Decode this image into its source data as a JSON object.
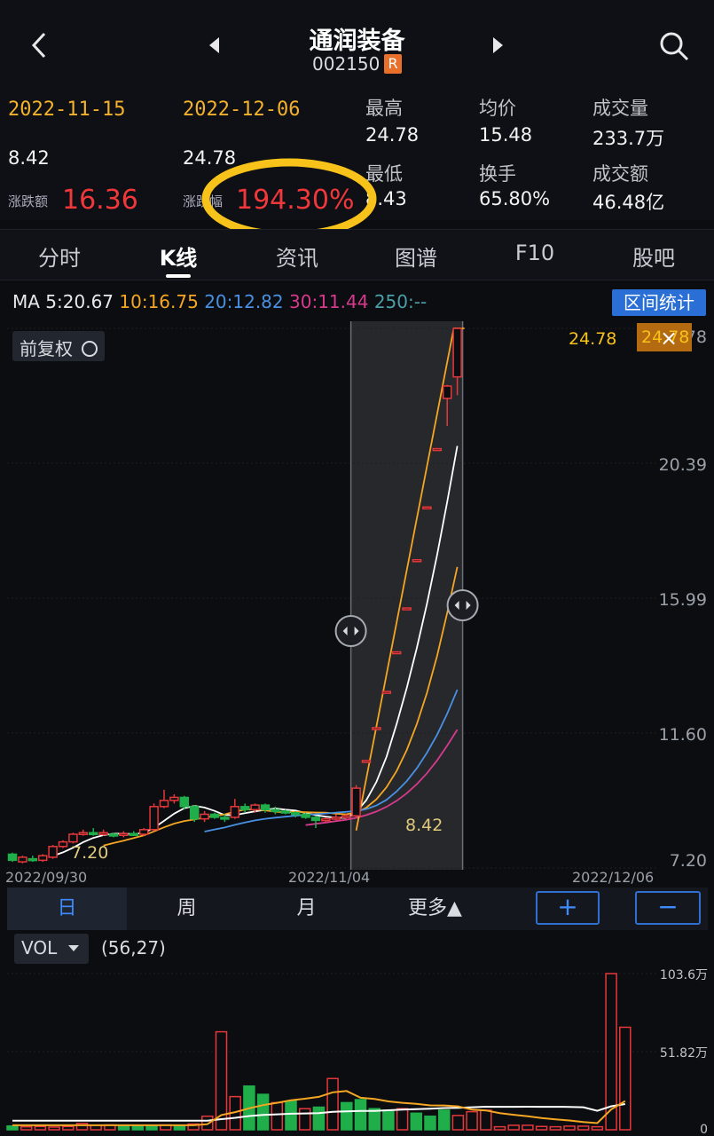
{
  "header": {
    "title": "通润装备",
    "code": "002150",
    "code_badge": "R"
  },
  "stats": {
    "start_date": "2022-11-15",
    "end_date": "2022-12-06",
    "start_price": "8.42",
    "end_price": "24.78",
    "change_label": "涨跌额",
    "change_value": "16.36",
    "pct_label": "涨跌幅",
    "pct_value": "194.30%",
    "high_label": "最高",
    "high_value": "24.78",
    "low_label": "最低",
    "low_value": "8.43",
    "avg_label": "均价",
    "avg_value": "15.48",
    "turnover_label": "换手",
    "turnover_value": "65.80%",
    "volume_label": "成交量",
    "volume_value": "233.7万",
    "amount_label": "成交额",
    "amount_value": "46.48亿"
  },
  "tabs": [
    "分时",
    "K线",
    "资讯",
    "图谱",
    "F10",
    "股吧"
  ],
  "ma_line": {
    "prefix": "MA",
    "ma5": "5:20.67",
    "ma10": "10:16.75",
    "ma20": "20:12.82",
    "ma30": "30:11.44",
    "ma250": "250:--"
  },
  "range_stats_button": "区间统计",
  "adjust_button": "前复权",
  "period_buttons": [
    "日",
    "周",
    "月",
    "更多▲"
  ],
  "zoom_in": "+",
  "zoom_out": "−",
  "volume_panel": {
    "selector": "VOL",
    "params": "(56,27)",
    "axis_labels": [
      "103.6万",
      "51.82万",
      "0"
    ]
  },
  "colors": {
    "up": "#e5383b",
    "down": "#1fae4a",
    "ma5": "#ffffff",
    "ma10": "#f5a623",
    "ma20": "#4a90e2",
    "ma30": "#d63a8c",
    "highlight": "#f7c21a",
    "accent": "#2a6fd6"
  },
  "chart_data": {
    "type": "candlestick",
    "price_axis": [
      "24.78",
      "20.39",
      "15.99",
      "11.60",
      "7.20"
    ],
    "price_ylim": [
      7.2,
      24.78
    ],
    "date_labels": [
      "2022/09/30",
      "2022/11/04",
      "2022/12/06"
    ],
    "markers": {
      "high_label": "24.78",
      "start_marker": "8.42",
      "low_marker": "7.20",
      "close_tag": "24.78"
    },
    "candles": [
      {
        "o": 7.65,
        "c": 7.45,
        "h": 7.7,
        "l": 7.4
      },
      {
        "o": 7.4,
        "c": 7.55,
        "h": 7.6,
        "l": 7.35
      },
      {
        "o": 7.5,
        "c": 7.45,
        "h": 7.6,
        "l": 7.4
      },
      {
        "o": 7.45,
        "c": 7.6,
        "h": 7.65,
        "l": 7.4
      },
      {
        "o": 7.55,
        "c": 7.9,
        "h": 7.95,
        "l": 7.5
      },
      {
        "o": 7.9,
        "c": 8.05,
        "h": 8.1,
        "l": 7.85
      },
      {
        "o": 8.05,
        "c": 8.3,
        "h": 8.35,
        "l": 8.0
      },
      {
        "o": 8.3,
        "c": 8.35,
        "h": 8.45,
        "l": 8.25
      },
      {
        "o": 8.35,
        "c": 8.3,
        "h": 8.5,
        "l": 8.25
      },
      {
        "o": 8.3,
        "c": 8.35,
        "h": 8.45,
        "l": 8.25
      },
      {
        "o": 8.3,
        "c": 8.28,
        "h": 8.35,
        "l": 8.2
      },
      {
        "o": 8.3,
        "c": 8.32,
        "h": 8.4,
        "l": 8.2
      },
      {
        "o": 8.32,
        "c": 8.3,
        "h": 8.4,
        "l": 8.25
      },
      {
        "o": 8.3,
        "c": 8.45,
        "h": 8.5,
        "l": 8.25
      },
      {
        "o": 8.45,
        "c": 9.2,
        "h": 9.3,
        "l": 8.4
      },
      {
        "o": 9.2,
        "c": 9.4,
        "h": 9.75,
        "l": 9.15
      },
      {
        "o": 9.4,
        "c": 9.5,
        "h": 9.6,
        "l": 9.3
      },
      {
        "o": 9.5,
        "c": 9.2,
        "h": 9.55,
        "l": 9.1
      },
      {
        "o": 9.2,
        "c": 8.8,
        "h": 9.25,
        "l": 8.7
      },
      {
        "o": 8.8,
        "c": 8.95,
        "h": 9.05,
        "l": 8.7
      },
      {
        "o": 8.95,
        "c": 8.85,
        "h": 9.0,
        "l": 8.8
      },
      {
        "o": 8.85,
        "c": 8.82,
        "h": 8.95,
        "l": 8.7
      },
      {
        "o": 8.85,
        "c": 9.2,
        "h": 9.45,
        "l": 8.8
      },
      {
        "o": 9.2,
        "c": 9.1,
        "h": 9.3,
        "l": 9.0
      },
      {
        "o": 9.1,
        "c": 9.25,
        "h": 9.3,
        "l": 9.0
      },
      {
        "o": 9.25,
        "c": 9.1,
        "h": 9.3,
        "l": 9.0
      },
      {
        "o": 9.1,
        "c": 9.05,
        "h": 9.2,
        "l": 8.95
      },
      {
        "o": 9.05,
        "c": 9.0,
        "h": 9.1,
        "l": 8.95
      },
      {
        "o": 9.0,
        "c": 8.95,
        "h": 9.05,
        "l": 8.85
      },
      {
        "o": 8.95,
        "c": 8.85,
        "h": 9.0,
        "l": 8.8
      },
      {
        "o": 8.85,
        "c": 8.75,
        "h": 8.9,
        "l": 8.5
      },
      {
        "o": 8.75,
        "c": 8.8,
        "h": 8.85,
        "l": 8.7
      },
      {
        "o": 8.8,
        "c": 8.85,
        "h": 8.95,
        "l": 8.75
      },
      {
        "o": 8.85,
        "c": 8.9,
        "h": 8.95,
        "l": 8.8
      },
      {
        "o": 8.9,
        "c": 9.8,
        "h": 9.9,
        "l": 8.85
      },
      {
        "o": 10.7,
        "c": 10.7,
        "h": 10.7,
        "l": 10.7
      },
      {
        "o": 11.77,
        "c": 11.77,
        "h": 11.77,
        "l": 11.77
      },
      {
        "o": 12.95,
        "c": 12.95,
        "h": 12.95,
        "l": 12.95
      },
      {
        "o": 14.24,
        "c": 14.24,
        "h": 14.24,
        "l": 14.24
      },
      {
        "o": 15.67,
        "c": 15.67,
        "h": 15.67,
        "l": 15.67
      },
      {
        "o": 17.24,
        "c": 17.24,
        "h": 17.24,
        "l": 17.24
      },
      {
        "o": 18.96,
        "c": 18.96,
        "h": 18.96,
        "l": 18.96
      },
      {
        "o": 20.86,
        "c": 20.86,
        "h": 20.86,
        "l": 20.86
      },
      {
        "o": 22.5,
        "c": 22.9,
        "h": 22.94,
        "l": 21.6
      },
      {
        "o": 23.2,
        "c": 24.78,
        "h": 24.78,
        "l": 22.6
      }
    ],
    "volume_ylim": [
      0,
      103.6
    ],
    "volumes": [
      {
        "v": 2.5,
        "d": 1
      },
      {
        "v": 2.0,
        "d": 0
      },
      {
        "v": 2.2,
        "d": 0
      },
      {
        "v": 1.8,
        "d": 0
      },
      {
        "v": 2.2,
        "d": 0
      },
      {
        "v": 4.2,
        "d": 0
      },
      {
        "v": 3.0,
        "d": 0
      },
      {
        "v": 3.2,
        "d": 0
      },
      {
        "v": 2.8,
        "d": 1
      },
      {
        "v": 2.5,
        "d": 1
      },
      {
        "v": 2.6,
        "d": 1
      },
      {
        "v": 3.2,
        "d": 0
      },
      {
        "v": 2.8,
        "d": 1
      },
      {
        "v": 3.8,
        "d": 0
      },
      {
        "v": 9.0,
        "d": 0
      },
      {
        "v": 65.0,
        "d": 0
      },
      {
        "v": 22.0,
        "d": 0
      },
      {
        "v": 29.0,
        "d": 1
      },
      {
        "v": 23.5,
        "d": 1
      },
      {
        "v": 18.0,
        "d": 0
      },
      {
        "v": 19.0,
        "d": 1
      },
      {
        "v": 14.0,
        "d": 0
      },
      {
        "v": 15.0,
        "d": 1
      },
      {
        "v": 34.0,
        "d": 0
      },
      {
        "v": 18.0,
        "d": 1
      },
      {
        "v": 20.0,
        "d": 1
      },
      {
        "v": 14.0,
        "d": 1
      },
      {
        "v": 13.0,
        "d": 1
      },
      {
        "v": 14.0,
        "d": 0
      },
      {
        "v": 11.0,
        "d": 1
      },
      {
        "v": 9.0,
        "d": 1
      },
      {
        "v": 13.0,
        "d": 1
      },
      {
        "v": 9.5,
        "d": 0
      },
      {
        "v": 12.0,
        "d": 0
      },
      {
        "v": 13.0,
        "d": 0
      },
      {
        "v": 2.0,
        "d": 0
      },
      {
        "v": 3.0,
        "d": 0
      },
      {
        "v": 3.0,
        "d": 0
      },
      {
        "v": 2.2,
        "d": 0
      },
      {
        "v": 2.0,
        "d": 0
      },
      {
        "v": 2.4,
        "d": 0
      },
      {
        "v": 2.4,
        "d": 0
      },
      {
        "v": 2.0,
        "d": 0
      },
      {
        "v": 103.6,
        "d": 0
      },
      {
        "v": 68.0,
        "d": 0
      }
    ]
  }
}
